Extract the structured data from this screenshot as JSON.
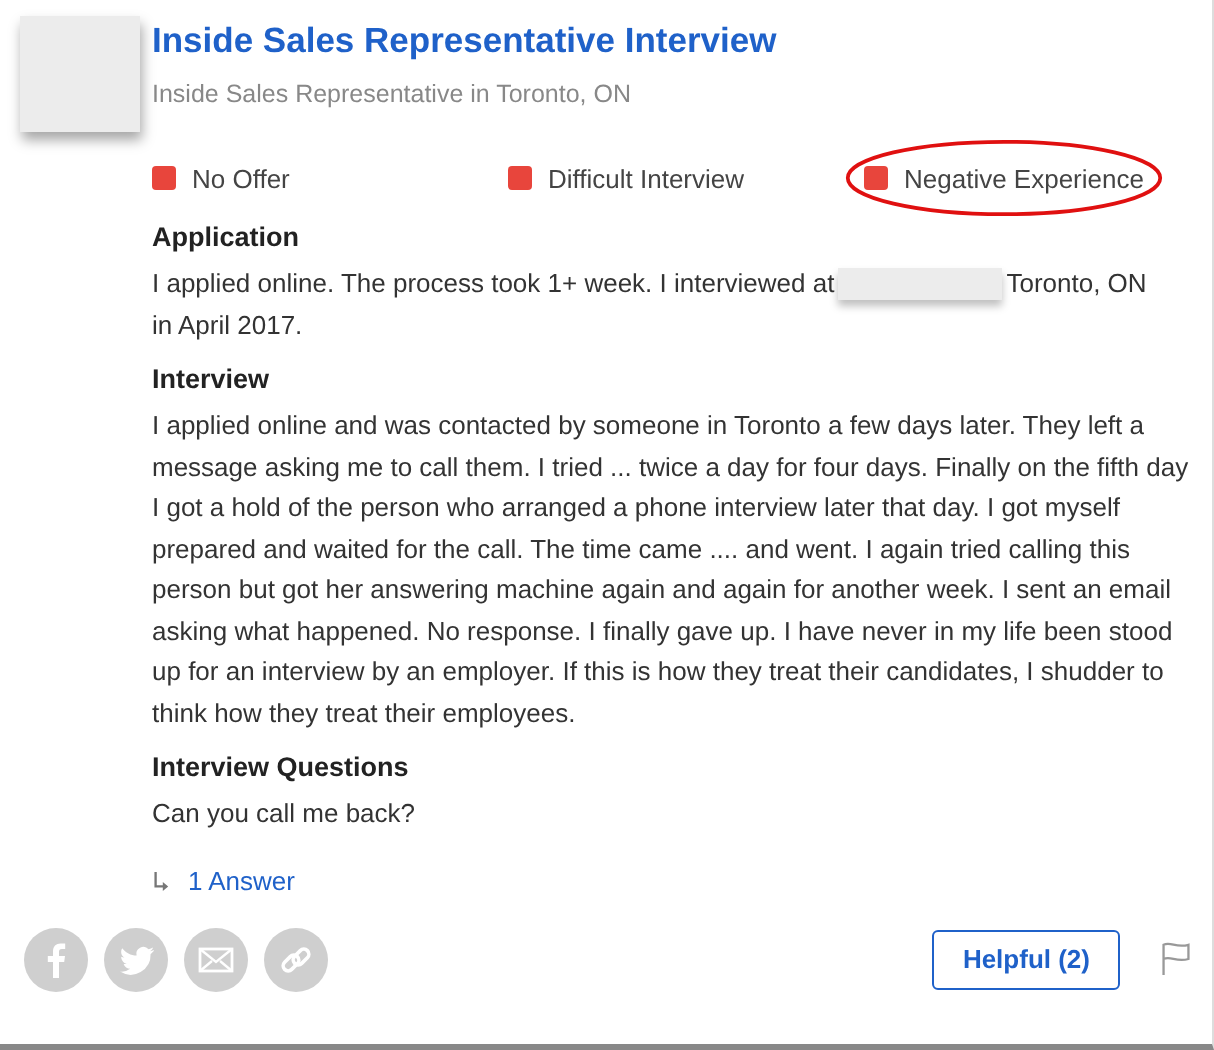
{
  "title": "Inside Sales Representative Interview",
  "subtitle": "Inside Sales Representative in Toronto, ON",
  "tags": [
    {
      "label": "No Offer",
      "color": "#e8453c",
      "circled": false
    },
    {
      "label": "Difficult Interview",
      "color": "#e8453c",
      "circled": false
    },
    {
      "label": "Negative Experience",
      "color": "#e8453c",
      "circled": true
    }
  ],
  "application": {
    "heading": "Application",
    "text_before": "I applied online. The process took 1+ week. I interviewed at",
    "text_after": "Toronto, ON",
    "text_next_line": "in April 2017."
  },
  "interview": {
    "heading": "Interview",
    "text": "I applied online and was contacted by someone in Toronto a few days later. They left a message asking me to call them. I tried ... twice a day for four days. Finally on the fifth day I got a hold of the person who arranged a phone interview later that day. I got myself prepared and waited for the call. The time came .... and went. I again tried calling this person but got her answering machine again and again for another week. I sent an email asking what happened. No response. I finally gave up. I have never in my life been stood up for an interview by an employer. If this is how they treat their candidates, I shudder to think how they treat their employees."
  },
  "questions": {
    "heading": "Interview Questions",
    "items": [
      "Can you call me back?"
    ]
  },
  "answers_link": "1 Answer",
  "share": [
    {
      "kind": "facebook"
    },
    {
      "kind": "twitter"
    },
    {
      "kind": "email"
    },
    {
      "kind": "link"
    }
  ],
  "helpful_button": "Helpful (2)"
}
